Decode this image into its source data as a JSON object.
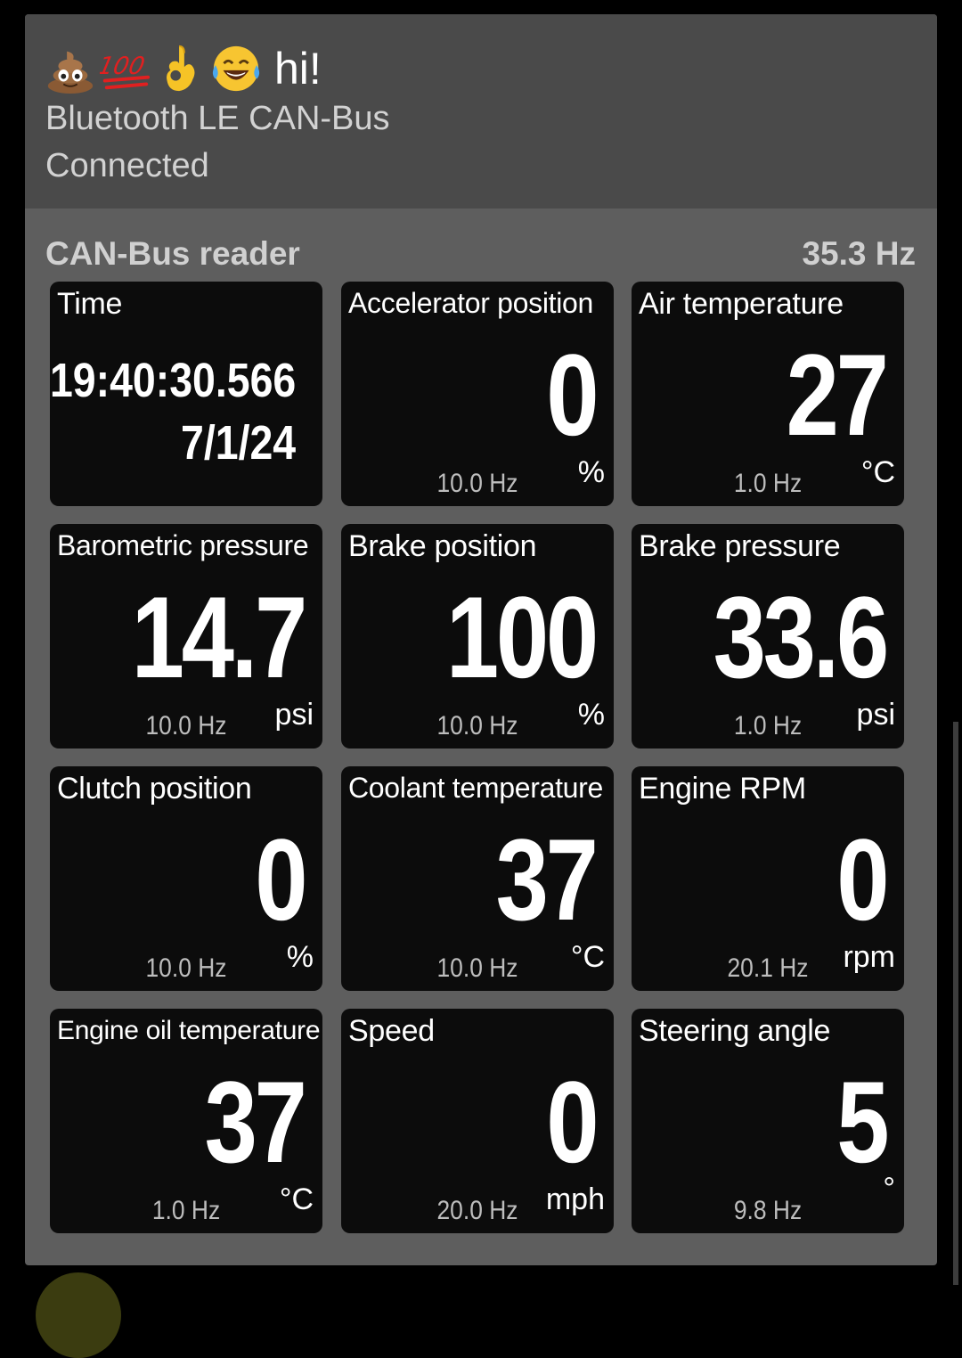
{
  "header": {
    "emojis": [
      "pile-of-poo",
      "hundred-points",
      "ok-hand",
      "tears-of-joy"
    ],
    "greeting": "hi!",
    "device": "Bluetooth LE CAN-Bus",
    "status": "Connected"
  },
  "section": {
    "title": "CAN-Bus reader",
    "rate": "35.3 Hz"
  },
  "tiles": [
    {
      "label": "Time",
      "time": "19:40:30.566",
      "date": "7/1/24"
    },
    {
      "label": "Accelerator position",
      "value": "0",
      "rate": "10.0 Hz",
      "unit": "%"
    },
    {
      "label": "Air temperature",
      "value": "27",
      "rate": "1.0 Hz",
      "unit": "°C"
    },
    {
      "label": "Barometric pressure",
      "value": "14.7",
      "rate": "10.0 Hz",
      "unit": "psi"
    },
    {
      "label": "Brake position",
      "value": "100",
      "rate": "10.0 Hz",
      "unit": "%"
    },
    {
      "label": "Brake pressure",
      "value": "33.6",
      "rate": "1.0 Hz",
      "unit": "psi"
    },
    {
      "label": "Clutch position",
      "value": "0",
      "rate": "10.0 Hz",
      "unit": "%"
    },
    {
      "label": "Coolant temperature",
      "value": "37",
      "rate": "10.0 Hz",
      "unit": "°C"
    },
    {
      "label": "Engine RPM",
      "value": "0",
      "rate": "20.1 Hz",
      "unit": "rpm"
    },
    {
      "label": "Engine oil temperature",
      "value": "37",
      "rate": "1.0 Hz",
      "unit": "°C"
    },
    {
      "label": "Speed",
      "value": "0",
      "rate": "20.0 Hz",
      "unit": "mph"
    },
    {
      "label": "Steering angle",
      "value": "5",
      "rate": "9.8 Hz",
      "unit": "°"
    }
  ],
  "colors": {
    "header_bg": "#4a4a4a",
    "card_bg": "#5e5e5e",
    "tile_bg": "#0c0c0c"
  }
}
